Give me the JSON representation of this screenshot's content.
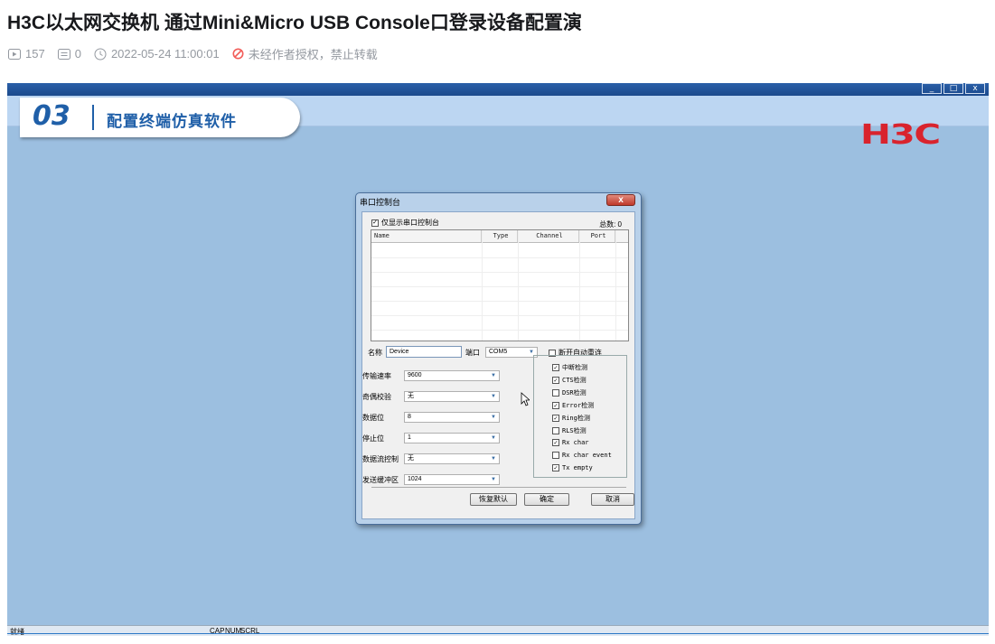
{
  "article": {
    "title": "H3C以太网交换机 通过Mini&Micro USB Console口登录设备配置演",
    "views": "157",
    "comments": "0",
    "datetime": "2022-05-24 11:00:01",
    "notice": "未经作者授权，禁止转载"
  },
  "video": {
    "step_number": "03",
    "step_title": "配置终端仿真软件",
    "logo": "H3C",
    "window_buttons": [
      "_",
      "□",
      "x"
    ],
    "status": {
      "ready": "就绪",
      "indicators": [
        "CAP",
        "NUM",
        "SCRL"
      ]
    },
    "dialog": {
      "title": "串口控制台",
      "close_label": "x",
      "show_only_label": "仅显示串口控制台",
      "show_only_checked": true,
      "total_label": "总数: 0",
      "columns": [
        "Name",
        "Type",
        "Channel",
        "Port"
      ],
      "name_label": "名称",
      "name_value": "Device",
      "port_label": "端口",
      "port_value": "COM5",
      "auto_reconnect_label": "断开自动重连",
      "auto_reconnect_checked": false,
      "fields": [
        {
          "label": "传输速率",
          "value": "9600"
        },
        {
          "label": "奇偶校验",
          "value": "无"
        },
        {
          "label": "数据位",
          "value": "8"
        },
        {
          "label": "停止位",
          "value": "1"
        },
        {
          "label": "数据流控制",
          "value": "无"
        },
        {
          "label": "发送缓冲区",
          "value": "1024"
        }
      ],
      "options": [
        {
          "label": "中断检测",
          "checked": true
        },
        {
          "label": "CTS检测",
          "checked": true
        },
        {
          "label": "DSR检测",
          "checked": false
        },
        {
          "label": "Error检测",
          "checked": true
        },
        {
          "label": "Ring检测",
          "checked": true
        },
        {
          "label": "RLS检测",
          "checked": false
        },
        {
          "label": "Rx char",
          "checked": true
        },
        {
          "label": "Rx char event",
          "checked": false
        },
        {
          "label": "Tx empty",
          "checked": true
        }
      ],
      "buttons": {
        "restore": "恢复默认",
        "ok": "确定",
        "cancel": "取消"
      }
    }
  },
  "colors": {
    "video_bg": "#9cbfe0",
    "accent": "#1f5fa8",
    "logo": "#d9232d",
    "warning": "#f25d59"
  }
}
